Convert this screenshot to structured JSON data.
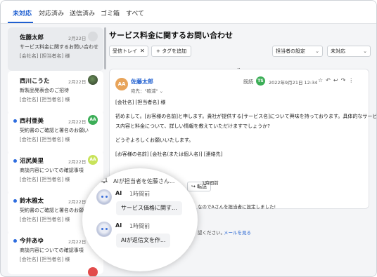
{
  "tabs": [
    "未対応",
    "対応済み",
    "送信済み",
    "ゴミ箱",
    "すべて"
  ],
  "conversations": [
    {
      "name": "佐藤太郎",
      "date": "2月22日",
      "subject": "サービス料金に関するお問い合わせ",
      "preview": "[会社名] [担当者名] 様",
      "avatar": "",
      "unread": false,
      "selected": true
    },
    {
      "name": "西川こうた",
      "date": "2月22日",
      "subject": "新製品発表会のご招待",
      "preview": "[会社名] [担当者名] 様",
      "avatar": "",
      "unread": false,
      "selected": false
    },
    {
      "name": "西村亜美",
      "date": "2月22日",
      "subject": "契約書のご確認と署名のお願い",
      "preview": "[会社名] [担当者名] 様",
      "avatar": "AA",
      "unread": true,
      "selected": false
    },
    {
      "name": "沼尻美里",
      "date": "2月22日",
      "subject": "商談内容についての確認事項",
      "preview": "[会社名] [担当者名] 様",
      "avatar": "AA",
      "unread": true,
      "selected": false
    },
    {
      "name": "鈴木雅太",
      "date": "2月22日",
      "subject": "契約書のご確認と署名のお願い",
      "preview": "[会社名] [担当者名] 様",
      "avatar": "",
      "unread": true,
      "selected": false
    },
    {
      "name": "今井あゆ",
      "date": "2月22日",
      "subject": "商談内容についての確認事項",
      "preview": "[会社名] [担当者名] 様",
      "avatar": "",
      "unread": true,
      "selected": false
    }
  ],
  "thread": {
    "subject": "サービス料金に関するお問い合わせ",
    "tag": "受信トレイ",
    "add_tag": "タグを追加",
    "assignee_select": "担当者の設定",
    "status_select": "未対応"
  },
  "mail": {
    "sender_initials": "AA",
    "sender": "佐藤太郎",
    "to": "宛先：\"確浦\"",
    "read_label": "既読",
    "reader_initials": "TS",
    "datetime": "2022年9月21日 12:34",
    "body": [
      "[会社名] [担当者名] 様",
      "初めまして。[お客様の名前]と申します。貴社が提供する[サービス名]について興味を持っております。具体的なサービ",
      "ス内容と料金について、詳しい情報を教えていただけますでしょうか?",
      "どうぞよろしくお願いいたします。",
      "[お客様の名前] [会社名(または個人名)] [連絡先]"
    ],
    "reply_label": "信",
    "forward_label": "転送"
  },
  "activity": {
    "time_fragment": "1時間前",
    "assign_fragment": "なのでAさんを担当者に設定しました!",
    "check_fragment": "認ください。",
    "mail_link": "メールを見る"
  },
  "lens": {
    "title": "AIが担当者を佐藤さん...",
    "items": [
      {
        "name": "AI",
        "time": "1時間前",
        "text": "サービス価格に関す..."
      },
      {
        "name": "AI",
        "time": "1時間前",
        "text": "AIが返信文を作..."
      }
    ]
  },
  "colors": {
    "accent": "#1f5fd0",
    "unread_dot": "#2d6cdf",
    "avatar_orange": "#e8a45a",
    "avatar_green": "#3cae57"
  }
}
